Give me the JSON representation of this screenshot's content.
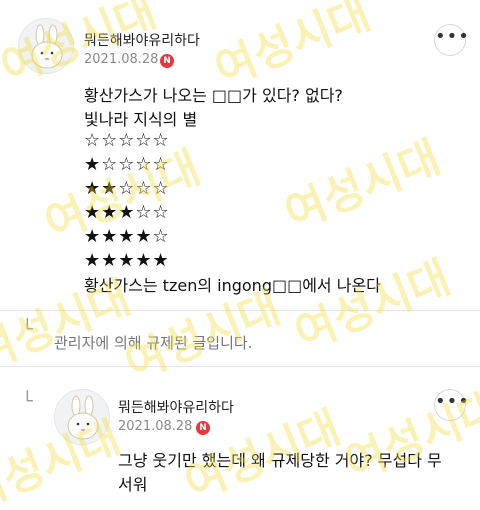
{
  "comment1": {
    "author": "뭐든해봐야유리하다",
    "date": "2021.08.28",
    "badge": "N",
    "more": "•••",
    "lines": [
      "황산가스가 나오는 □□가 있다? 없다?",
      "빛나라 지식의 별"
    ],
    "star_ratings": [
      0,
      1,
      2,
      3,
      4,
      5
    ],
    "star_max": 5,
    "last_line": "황산가스는 tzen의 ingong□□에서 나온다"
  },
  "deleted": {
    "mark": "└",
    "text": "관리자에 의해 규제된 글입니다."
  },
  "comment2": {
    "mark": "└",
    "author": "뭐든해봐야유리하다",
    "date": "2021.08.28",
    "badge": "N",
    "more": "•••",
    "lines": [
      "그냥 웃기만 했는데 왜 규제당한 거야? 무섭다 무",
      "서워"
    ]
  },
  "watermark": "여성시대",
  "colors": {
    "badge": "#e8363d",
    "watermark": "#f2de3c"
  }
}
